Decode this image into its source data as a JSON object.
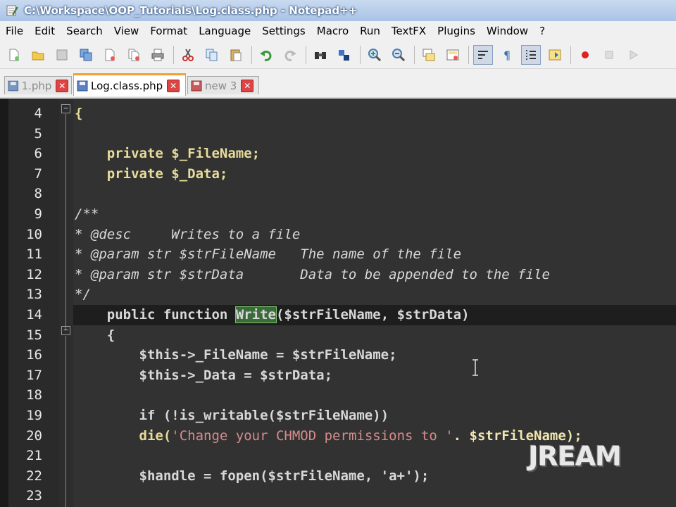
{
  "window": {
    "title": "C:\\Workspace\\OOP_Tutorials\\Log.class.php - Notepad++"
  },
  "menu": [
    "File",
    "Edit",
    "Search",
    "View",
    "Format",
    "Language",
    "Settings",
    "Macro",
    "Run",
    "TextFX",
    "Plugins",
    "Window",
    "?"
  ],
  "toolbar": {
    "icons": [
      "new-file-icon",
      "open-file-icon",
      "save-icon",
      "save-all-icon",
      "close-icon",
      "close-all-icon",
      "print-icon",
      "cut-icon",
      "copy-icon",
      "paste-icon",
      "undo-icon",
      "redo-icon",
      "find-icon",
      "replace-icon",
      "zoom-in-icon",
      "zoom-out-icon",
      "sync-vertical-icon",
      "sync-horizontal-icon",
      "word-wrap-icon",
      "show-all-chars-icon",
      "indent-guide-icon",
      "doc-map-icon",
      "record-macro-icon",
      "stop-record-icon",
      "play-macro-icon"
    ]
  },
  "tabs": [
    {
      "label": "1.php",
      "active": false
    },
    {
      "label": "Log.class.php",
      "active": true
    },
    {
      "label": "new  3",
      "active": false
    }
  ],
  "editor": {
    "lines": [
      {
        "n": "4",
        "text": "{"
      },
      {
        "n": "5",
        "text": ""
      },
      {
        "n": "6",
        "text": "    private $_FileName;"
      },
      {
        "n": "7",
        "text": "    private $_Data;"
      },
      {
        "n": "8",
        "text": ""
      },
      {
        "n": "9",
        "text": "/**"
      },
      {
        "n": "10",
        "text": "* @desc     Writes to a file"
      },
      {
        "n": "11",
        "text": "* @param str $strFileName   The name of the file"
      },
      {
        "n": "12",
        "text": "* @param str $strData       Data to be appended to the file"
      },
      {
        "n": "13",
        "text": "*/"
      },
      {
        "n": "14",
        "text": "    public function Write($strFileName, $strData)"
      },
      {
        "n": "15",
        "text": "    {"
      },
      {
        "n": "16",
        "text": "        $this->_FileName = $strFileName;"
      },
      {
        "n": "17",
        "text": "        $this->_Data = $strData;"
      },
      {
        "n": "18",
        "text": ""
      },
      {
        "n": "19",
        "text": "        if (!is_writable($strFileName))"
      },
      {
        "n": "20",
        "text": "        die('Change your CHMOD permissions to '. $strFileName);"
      },
      {
        "n": "21",
        "text": ""
      },
      {
        "n": "22",
        "text": "        $handle = fopen($strFileName, 'a+');"
      },
      {
        "n": "23",
        "text": ""
      }
    ],
    "current_line": "14",
    "match_word": "Write"
  },
  "watermark": "JREAM"
}
